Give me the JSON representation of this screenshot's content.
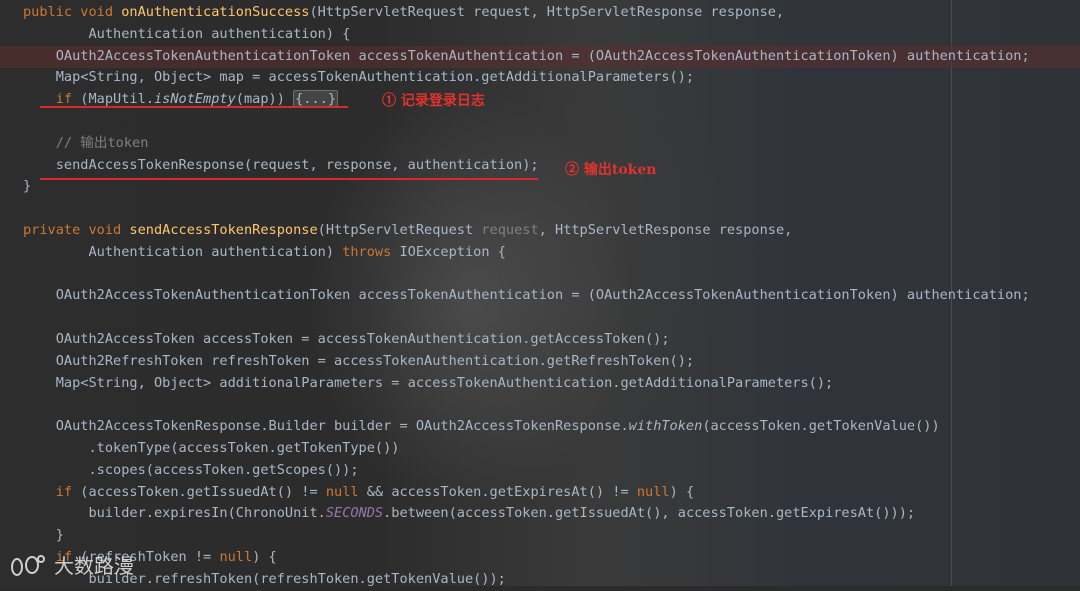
{
  "editor": {
    "lines": {
      "l0": [
        "public void ",
        "onAuthenticationSuccess",
        "(HttpServletRequest request, HttpServletResponse response,"
      ],
      "l1": "        Authentication authentication) {",
      "l2": "    OAuth2AccessTokenAuthenticationToken accessTokenAuthentication = (OAuth2AccessTokenAuthenticationToken) authentication;",
      "l3": "    Map<String, Object> map = accessTokenAuthentication.getAdditionalParameters();",
      "l4": [
        "    if",
        " (MapUtil.",
        "isNotEmpty",
        "(map)) ",
        "{...}"
      ],
      "l6": "    // 输出token",
      "l7": "    sendAccessTokenResponse(request, response, authentication);",
      "l8": "}",
      "l10": [
        "private void ",
        "sendAccessTokenResponse",
        "(HttpServletRequest ",
        "request",
        ", HttpServletResponse response,"
      ],
      "l11": [
        "        Authentication authentication) ",
        "throws",
        " IOException {"
      ],
      "l13": "    OAuth2AccessTokenAuthenticationToken accessTokenAuthentication = (OAuth2AccessTokenAuthenticationToken) authentication;",
      "l15": "    OAuth2AccessToken accessToken = accessTokenAuthentication.getAccessToken();",
      "l16": "    OAuth2RefreshToken refreshToken = accessTokenAuthentication.getRefreshToken();",
      "l17": "    Map<String, Object> additionalParameters = accessTokenAuthentication.getAdditionalParameters();",
      "l19": [
        "    OAuth2AccessTokenResponse.Builder builder = OAuth2AccessTokenResponse.",
        "withToken",
        "(accessToken.getTokenValue())"
      ],
      "l20": "        .tokenType(accessToken.getTokenType())",
      "l21": "        .scopes(accessToken.getScopes());",
      "l22": [
        "    if",
        " (accessToken.getIssuedAt() != ",
        "null",
        " && accessToken.getExpiresAt() != ",
        "null",
        ") {"
      ],
      "l23": [
        "        builder.expiresIn(ChronoUnit.",
        "SECONDS",
        ".between(accessToken.getIssuedAt(), accessToken.getExpiresAt()));"
      ],
      "l24": "    }",
      "l25": [
        "    if",
        " (refreshToken != ",
        "null",
        ") {"
      ],
      "l26": "        builder.refreshToken(refreshToken.getTokenValue());"
    }
  },
  "annotations": {
    "a1": "① 记录登录日志",
    "a2": "② 输出token"
  },
  "watermark": {
    "text": "大数路漫",
    "logo": "footprint-logo-icon"
  },
  "colors": {
    "keyword": "#cc7832",
    "method": "#ffc66d",
    "text": "#a9b7c6",
    "comment": "#808080",
    "static": "#9876aa",
    "annotation": "#e0332e",
    "error_line": "#5f2d2d"
  }
}
